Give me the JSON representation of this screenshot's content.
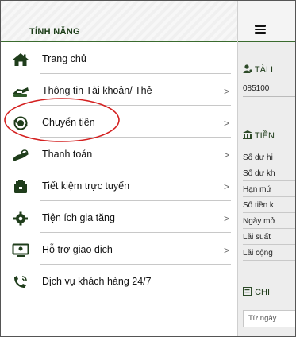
{
  "drawer": {
    "title": "TÍNH NĂNG",
    "items": [
      {
        "label": "Trang chủ",
        "icon": "home-icon",
        "chevron": ""
      },
      {
        "label": "Thông tin Tài khoản/ Thẻ",
        "icon": "card-icon",
        "chevron": ">"
      },
      {
        "label": "Chuyển tiền",
        "icon": "transfer-icon",
        "chevron": ">"
      },
      {
        "label": "Thanh toán",
        "icon": "payment-icon",
        "chevron": ">"
      },
      {
        "label": "Tiết kiệm trực tuyến",
        "icon": "savings-icon",
        "chevron": ">"
      },
      {
        "label": "Tiện ích gia tăng",
        "icon": "utilities-icon",
        "chevron": ">"
      },
      {
        "label": "Hỗ trợ giao dịch",
        "icon": "support-icon",
        "chevron": ">"
      },
      {
        "label": "Dịch vụ khách hàng 24/7",
        "icon": "phone-icon",
        "chevron": ""
      }
    ]
  },
  "page": {
    "account_section_title": "TÀI I",
    "account_number": "085100",
    "info_section_title": "TIỀN",
    "info_rows": [
      "Số dư hi",
      "Số dư kh",
      "Hạn mứ",
      "Số tiền k",
      "Ngày mở",
      "Lãi suất",
      "Lãi cộng"
    ],
    "detail_section_title": "CHI",
    "date_placeholder": "Từ ngày"
  },
  "colors": {
    "accent": "#3a6b2e",
    "icon_dark": "#1f3d1b",
    "highlight_circle": "#d42020"
  }
}
